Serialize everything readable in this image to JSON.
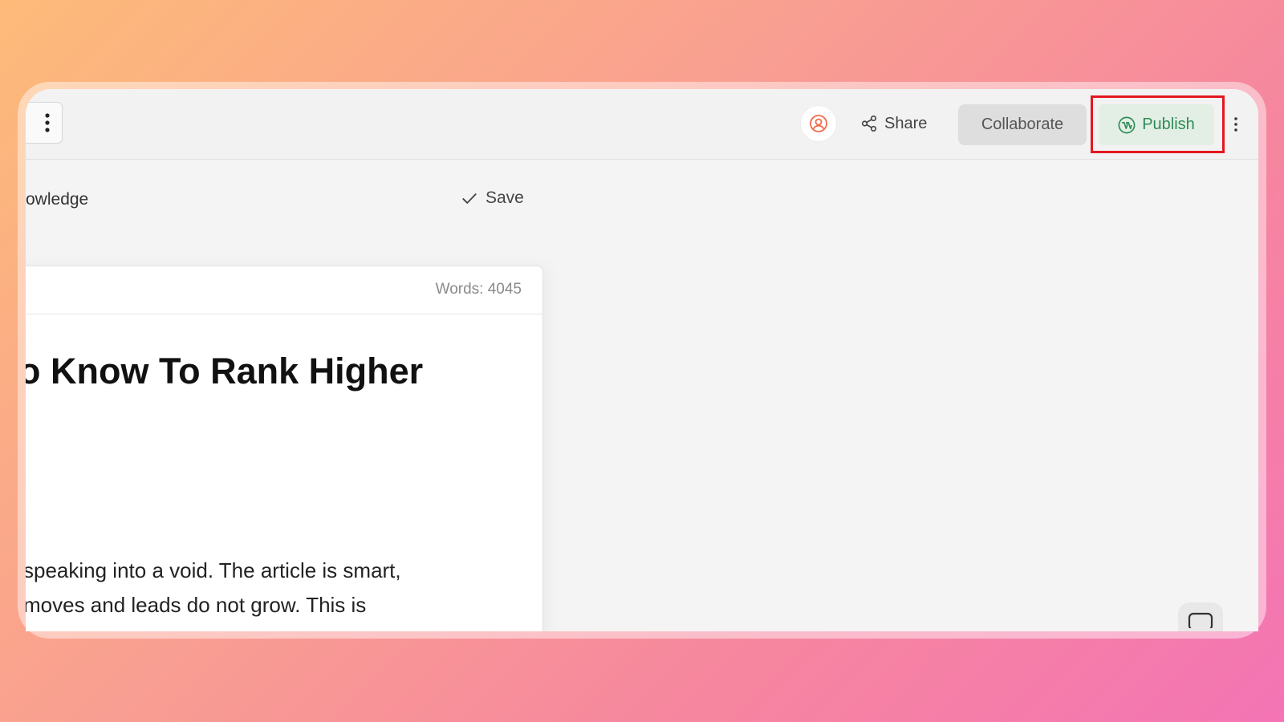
{
  "toolbar": {
    "share_label": "Share",
    "collaborate_label": "Collaborate",
    "publish_label": "Publish"
  },
  "editor": {
    "breadcrumb_fragment": "owledge",
    "save_label": "Save",
    "word_count": "Words: 4045",
    "heading_fragment": "o Know To Rank Higher",
    "paragraph_lines": [
      "speaking into a void. The article is smart,",
      "moves and leads do not grow. This is"
    ]
  },
  "colors": {
    "publish_accent": "#2e8b57",
    "highlight": "#e3171f",
    "avatar_accent": "#f26b4b"
  },
  "icons": [
    "more-vertical-icon",
    "user-circle-icon",
    "share-icon",
    "wordpress-icon",
    "checkmark-icon",
    "chat-icon"
  ]
}
